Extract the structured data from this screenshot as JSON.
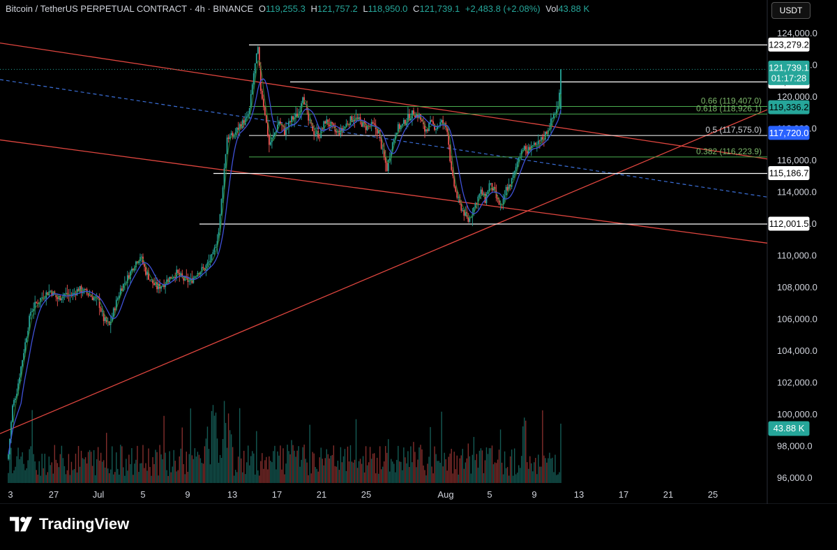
{
  "header": {
    "symbol": "Bitcoin / TetherUS PERPETUAL CONTRACT · 4h · BINANCE",
    "o_label": "O",
    "o_value": "119,255.3",
    "h_label": "H",
    "h_value": "121,757.2",
    "l_label": "L",
    "l_value": "118,950.0",
    "c_label": "C",
    "c_value": "121,739.1",
    "change": "+2,483.8 (+2.08%)",
    "vol_label": "Vol",
    "vol_value": "43.88 K"
  },
  "currency_button": "USDT",
  "brand": "TradingView",
  "colors": {
    "background": "#000000",
    "up": "#26a69a",
    "down": "#ef5350",
    "ma": "#3f51d8",
    "channel": "#e0463f",
    "fib": "#4caf50",
    "level": "#ffffff",
    "blue_label": "#2962ff"
  },
  "chart_data": {
    "type": "candlestick",
    "symbol": "BTCUSDT.P",
    "interval": "4h",
    "ylim": [
      95000,
      125000
    ],
    "y_ticks": [
      "124,000.0",
      "122,000.0",
      "120,000.0",
      "118,000.0",
      "116,000.0",
      "114,000.0",
      "112,000.0",
      "110,000.0",
      "108,000.0",
      "106,000.0",
      "104,000.0",
      "102,000.0",
      "100,000.0",
      "98,000.0",
      "96,000.0"
    ],
    "x_ticks": [
      "3",
      "27",
      "Jul",
      "5",
      "9",
      "13",
      "17",
      "21",
      "25",
      "Aug",
      "5",
      "9",
      "13",
      "17",
      "21",
      "25"
    ],
    "last_price": "121,739.1",
    "countdown": "01:17:28",
    "volume_label": "43.88 K",
    "horizontal_levels": [
      {
        "price": 123279.2,
        "label": "123,279.2"
      },
      {
        "price": 120951.5,
        "label": "120,951.5"
      },
      {
        "price": 115186.7,
        "label": "115,186.7"
      },
      {
        "price": 112001.5,
        "label": "112,001.5"
      }
    ],
    "fib_levels": [
      {
        "ratio": "0.66",
        "price": 119407.0,
        "text": "0.66 (119,407.0)"
      },
      {
        "ratio": "0.618",
        "price": 118926.1,
        "text": "0.618 (118,926.1)"
      },
      {
        "ratio": "0.5",
        "price": 117575.0,
        "text": "0.5 (117,575.0)"
      },
      {
        "ratio": "0.382",
        "price": 116223.9,
        "text": "0.382 (116,223.9)"
      }
    ],
    "price_labels": [
      {
        "price": 119336.2,
        "label": "119,336.2",
        "style": "green"
      },
      {
        "price": 117720.0,
        "label": "117,720.0",
        "style": "blue"
      }
    ],
    "close_path": [
      [
        0,
        97500
      ],
      [
        3,
        100500
      ],
      [
        6,
        101500
      ],
      [
        9,
        103000
      ],
      [
        12,
        104500
      ],
      [
        16,
        106500
      ],
      [
        20,
        107000
      ],
      [
        25,
        107500
      ],
      [
        30,
        107800
      ],
      [
        35,
        107300
      ],
      [
        40,
        107600
      ],
      [
        45,
        107500
      ],
      [
        50,
        107900
      ],
      [
        55,
        107700
      ],
      [
        60,
        107400
      ],
      [
        64,
        107200
      ],
      [
        68,
        106000
      ],
      [
        72,
        105600
      ],
      [
        76,
        106800
      ],
      [
        80,
        107900
      ],
      [
        85,
        108600
      ],
      [
        90,
        109500
      ],
      [
        94,
        110000
      ],
      [
        98,
        109000
      ],
      [
        102,
        108400
      ],
      [
        106,
        108000
      ],
      [
        110,
        108200
      ],
      [
        115,
        108600
      ],
      [
        120,
        108900
      ],
      [
        125,
        108500
      ],
      [
        130,
        108400
      ],
      [
        135,
        109000
      ],
      [
        140,
        109200
      ],
      [
        146,
        110000
      ],
      [
        150,
        111500
      ],
      [
        153,
        114500
      ],
      [
        156,
        117500
      ],
      [
        160,
        117500
      ],
      [
        165,
        118200
      ],
      [
        170,
        118600
      ],
      [
        172,
        119200
      ],
      [
        175,
        121500
      ],
      [
        178,
        123000
      ],
      [
        180,
        120500
      ],
      [
        183,
        119000
      ],
      [
        186,
        117000
      ],
      [
        189,
        117500
      ],
      [
        193,
        118500
      ],
      [
        197,
        117800
      ],
      [
        202,
        118600
      ],
      [
        207,
        118900
      ],
      [
        210,
        120200
      ],
      [
        214,
        118500
      ],
      [
        218,
        117800
      ],
      [
        222,
        117600
      ],
      [
        226,
        118500
      ],
      [
        230,
        118200
      ],
      [
        234,
        117700
      ],
      [
        238,
        117900
      ],
      [
        242,
        118400
      ],
      [
        246,
        118700
      ],
      [
        250,
        118500
      ],
      [
        255,
        118100
      ],
      [
        260,
        118200
      ],
      [
        264,
        117800
      ],
      [
        267,
        116500
      ],
      [
        270,
        115500
      ],
      [
        273,
        116800
      ],
      [
        277,
        118000
      ],
      [
        281,
        118200
      ],
      [
        285,
        118700
      ],
      [
        289,
        119000
      ],
      [
        293,
        118800
      ],
      [
        297,
        117900
      ],
      [
        301,
        118300
      ],
      [
        305,
        118100
      ],
      [
        309,
        118400
      ],
      [
        313,
        118000
      ],
      [
        316,
        115200
      ],
      [
        319,
        114000
      ],
      [
        322,
        113200
      ],
      [
        325,
        112700
      ],
      [
        328,
        112200
      ],
      [
        331,
        112800
      ],
      [
        334,
        113500
      ],
      [
        337,
        114000
      ],
      [
        340,
        113500
      ],
      [
        343,
        114500
      ],
      [
        346,
        114100
      ],
      [
        349,
        113400
      ],
      [
        352,
        113000
      ],
      [
        355,
        114200
      ],
      [
        358,
        114500
      ],
      [
        361,
        115200
      ],
      [
        364,
        116300
      ],
      [
        367,
        116800
      ],
      [
        370,
        116500
      ],
      [
        373,
        117000
      ],
      [
        376,
        116800
      ],
      [
        379,
        117200
      ],
      [
        382,
        117500
      ],
      [
        386,
        118200
      ],
      [
        389,
        118900
      ],
      [
        392,
        119300
      ],
      [
        394,
        121739
      ]
    ]
  }
}
